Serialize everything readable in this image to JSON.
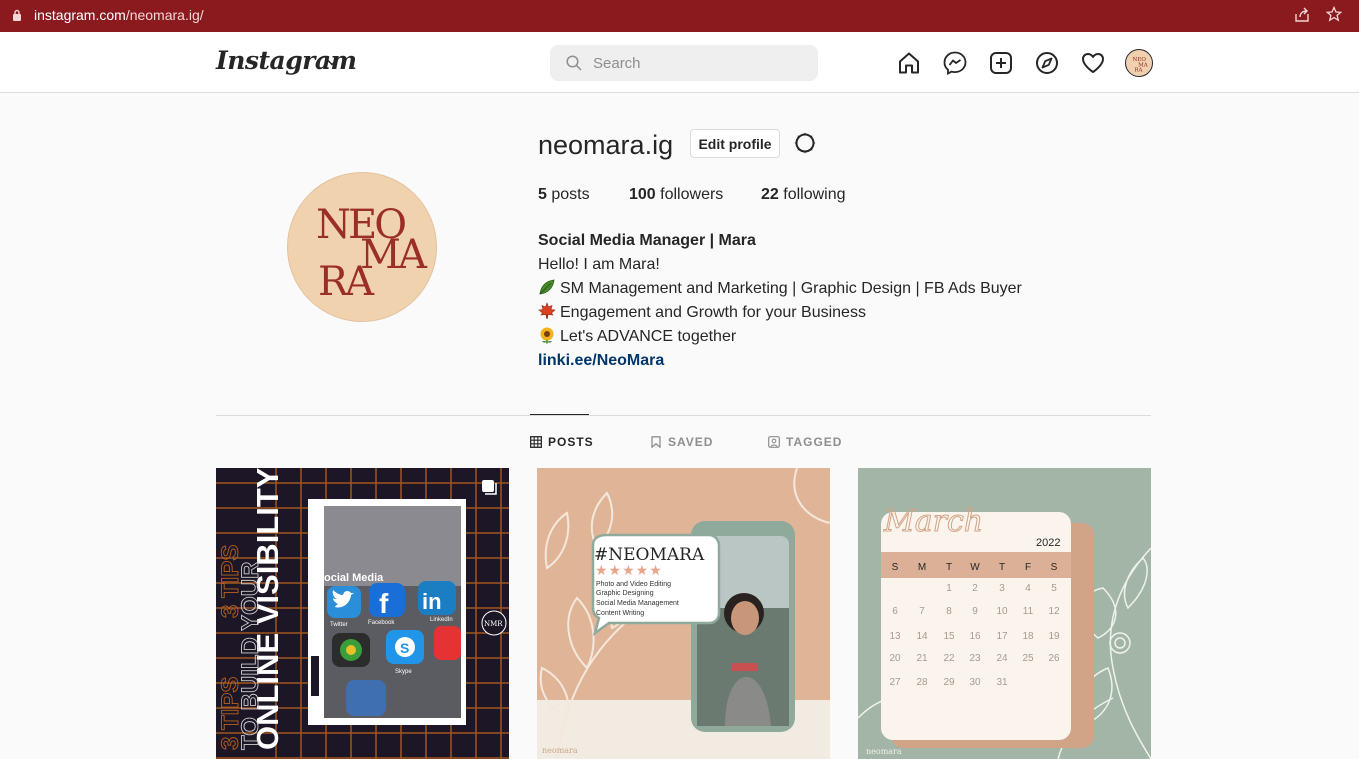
{
  "browser": {
    "url_domain": "instagram.com",
    "url_path": "/neomara.ig/"
  },
  "nav": {
    "logo": "Instagram",
    "search_placeholder": "Search",
    "icons": [
      "home-icon",
      "messenger-icon",
      "new-post-icon",
      "explore-icon",
      "activity-icon",
      "profile-avatar"
    ]
  },
  "profile": {
    "username": "neomara.ig",
    "edit_label": "Edit profile",
    "avatar_text": [
      "NEO",
      "MA",
      "RA"
    ],
    "stats": {
      "posts_count": "5",
      "posts_label": "posts",
      "followers_count": "100",
      "followers_label": "followers",
      "following_count": "22",
      "following_label": "following"
    },
    "bio": {
      "full_name": "Social Media Manager | Mara",
      "line1": "Hello! I am Mara!",
      "line2": "SM Management and Marketing | Graphic Design | FB Ads Buyer",
      "line3": "Engagement and Growth for your Business",
      "line4": "Let's ADVANCE together",
      "link": "linki.ee/NeoMara"
    }
  },
  "tabs": {
    "posts": "POSTS",
    "saved": "SAVED",
    "tagged": "TAGGED"
  },
  "posts": {
    "post1": {
      "vertical_text_1": "3 TIPS",
      "vertical_text_2": "TO BUILD YOUR",
      "vertical_text_3": "ONLINE VISIBILITY",
      "phone_label": "ocial Media",
      "app1": "Twitter",
      "app2": "Facebook",
      "app3": "LinkedIn",
      "app4": "Skype",
      "badge": "NMR"
    },
    "post2": {
      "hashtag": "#NEOMARA",
      "services": [
        "Photo and Video Editing",
        "Graphic Designing",
        "Social Media Management",
        "Content Writing"
      ],
      "footer": "neomara"
    },
    "post3": {
      "month": "March",
      "year": "2022",
      "days": [
        "S",
        "M",
        "T",
        "W",
        "T",
        "F",
        "S"
      ],
      "dates": [
        [
          "",
          "",
          "1",
          "2",
          "3",
          "4",
          "5"
        ],
        [
          "6",
          "7",
          "8",
          "9",
          "10",
          "11",
          "12"
        ],
        [
          "13",
          "14",
          "15",
          "16",
          "17",
          "18",
          "19"
        ],
        [
          "20",
          "21",
          "22",
          "23",
          "24",
          "25",
          "26"
        ],
        [
          "27",
          "28",
          "29",
          "30",
          "31",
          "",
          ""
        ]
      ],
      "footer": "neomara"
    }
  },
  "colors": {
    "browser_bar": "#8b1a1f",
    "link": "#00376b",
    "post2_bg": "#e0b497",
    "post3_bg": "#a3b5a6"
  }
}
